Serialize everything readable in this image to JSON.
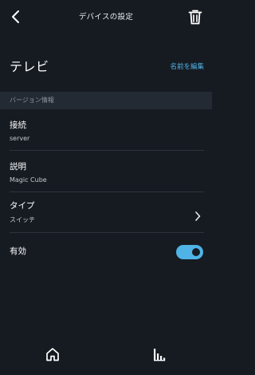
{
  "header": {
    "title": "デバイスの設定",
    "back_icon": "back-arrow-icon",
    "trash_icon": "trash-icon"
  },
  "device": {
    "name": "テレビ",
    "edit_name_label": "名前を編集"
  },
  "section": {
    "version_info_label": "バージョン情報"
  },
  "rows": {
    "connection": {
      "title": "接続",
      "value": "server"
    },
    "description": {
      "title": "説明",
      "value": "Magic Cube"
    },
    "type": {
      "title": "タイプ",
      "value": "スイッチ"
    },
    "enabled": {
      "title": "有効",
      "toggle_on": true
    }
  },
  "bottom_nav": {
    "home_icon": "home-icon",
    "devices_icon": "devices-icon"
  },
  "colors": {
    "background": "#161b22",
    "accent": "#4fb3e6",
    "section_bg": "#242a33"
  }
}
